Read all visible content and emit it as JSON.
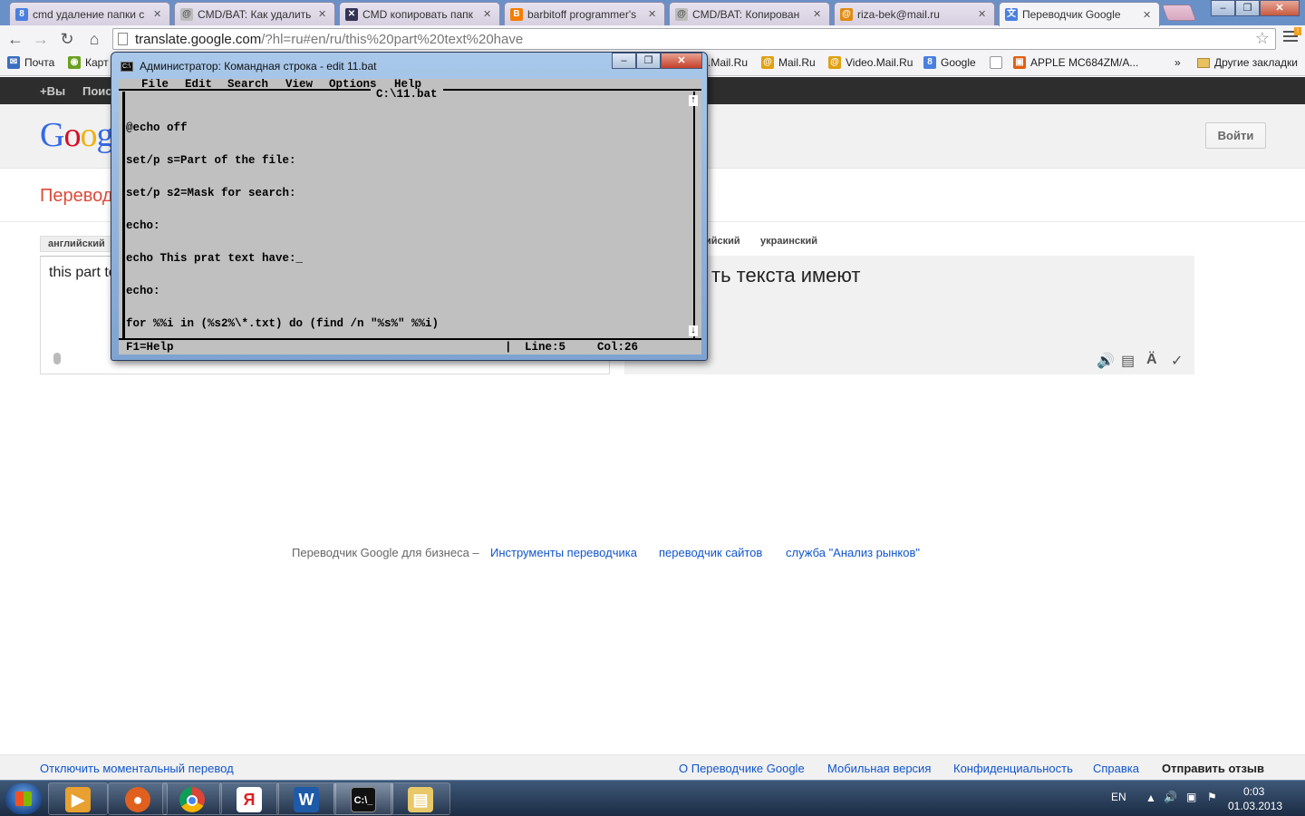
{
  "browser": {
    "tabs": [
      {
        "label": "cmd удаление папки с",
        "icon": "google-icon"
      },
      {
        "label": "CMD/BAT: Как удалить",
        "icon": "forum-icon"
      },
      {
        "label": "CMD копировать папк",
        "icon": "site-icon"
      },
      {
        "label": "barbitoff programmer's",
        "icon": "blogger-icon"
      },
      {
        "label": "CMD/BAT: Копирован",
        "icon": "forum-icon"
      },
      {
        "label": "riza-bek@mail.ru",
        "icon": "mail-icon"
      },
      {
        "label": "Переводчик Google",
        "icon": "google-translate-icon"
      }
    ],
    "url_host": "translate.google.com",
    "url_path": "/?hl=ru#en/ru/this%20part%20text%20have",
    "bookmarks": [
      "Почта",
      "Карт",
      ".Mail.Ru",
      "Mail.Ru",
      "Video.Mail.Ru",
      "Google",
      "",
      "APPLE MC684ZM/A...",
      "»",
      "Другие закладки"
    ]
  },
  "google": {
    "bar_items": [
      "+Вы",
      "Поис"
    ],
    "logo_text": "Goog",
    "signin_label": "Войти",
    "page_title": "Перевод",
    "source_lang": "английский",
    "target_langs": [
      "ийский",
      "украинский"
    ],
    "source_text": "this part te",
    "translated_text": "ть текста имеют",
    "business_label": "Переводчик Google для бизнеса –",
    "business_links": [
      "Инструменты переводчика",
      "переводчик сайтов",
      "служба \"Анализ рынков\""
    ],
    "footer_left": "Отключить моментальный перевод",
    "footer_links": [
      "О Переводчике Google",
      "Мобильная версия",
      "Конфиденциальность",
      "Справка"
    ],
    "footer_feedback": "Отправить отзыв"
  },
  "cmd_window": {
    "title": "Администратор: Командная строка - edit  11.bat",
    "menu": [
      "File",
      "Edit",
      "Search",
      "View",
      "Options",
      "Help"
    ],
    "file_title": "C:\\11.bat",
    "lines": [
      "@echo off",
      "set/p s=Part of the file:",
      "set/p s2=Mask for search:",
      "echo:",
      "echo This prat text have:_",
      "echo:",
      "for %%i in (%s2%\\*.txt) do (find /n \"%s%\" %%i)"
    ],
    "status_help": "F1=Help",
    "status_line": "Line:5",
    "status_col": "Col:26"
  },
  "taskbar": {
    "apps": [
      "media-player-icon",
      "firefox-icon",
      "chrome-icon",
      "yandex-icon",
      "word-icon",
      "cmd-icon",
      "explorer-icon"
    ],
    "lang": "EN",
    "time": "0:03",
    "date": "01.03.2013"
  }
}
